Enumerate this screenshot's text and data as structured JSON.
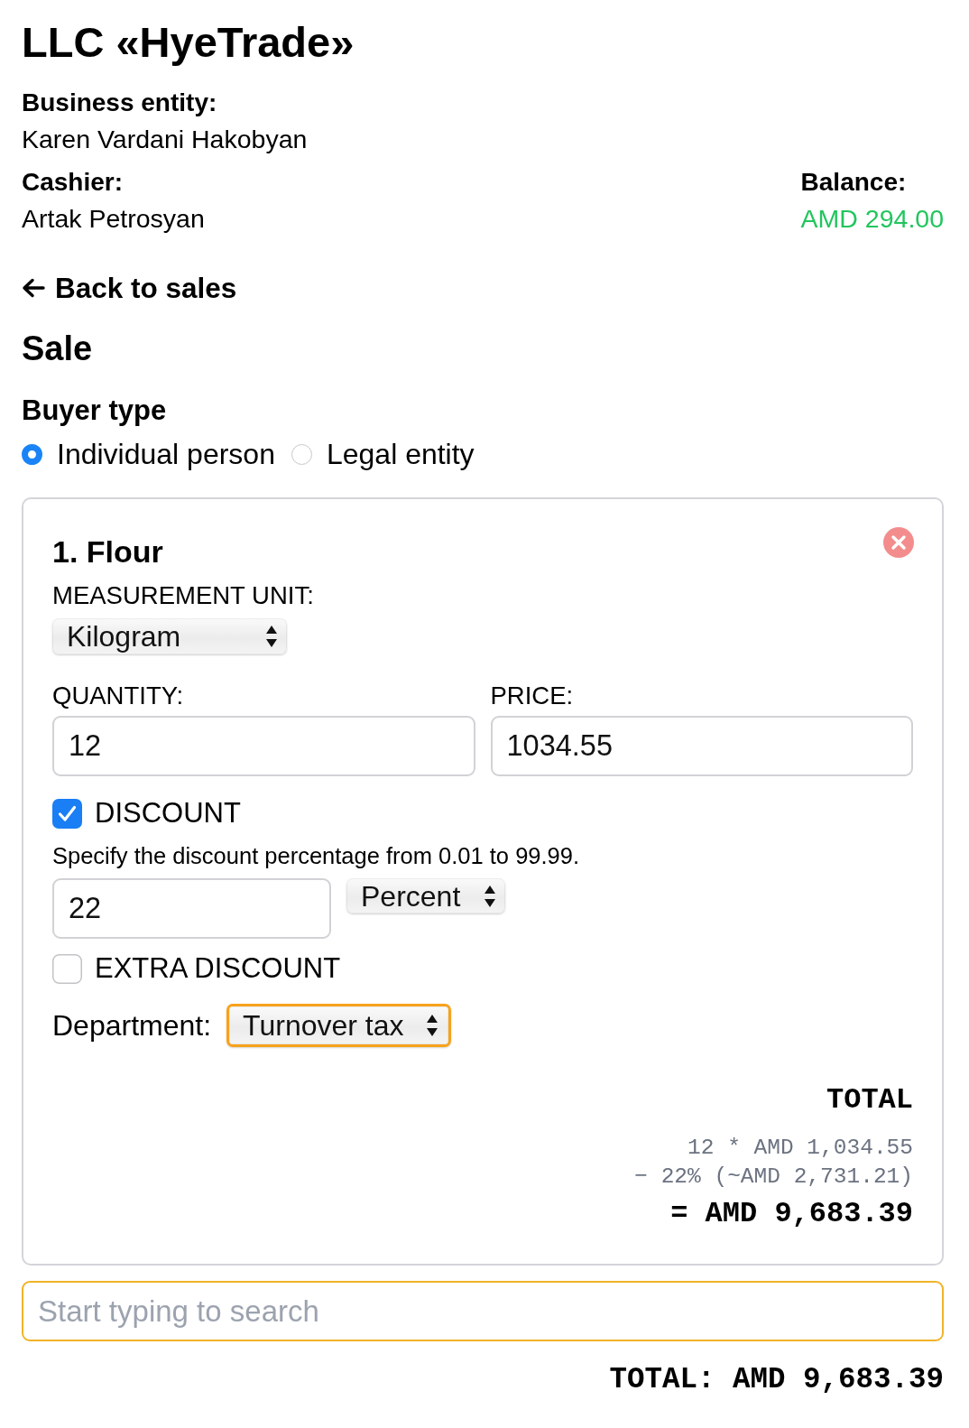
{
  "company": {
    "name": "LLC «HyeTrade»"
  },
  "info": {
    "business_entity": {
      "label": "Business entity:",
      "value": "Karen Vardani Hakobyan"
    },
    "cashier": {
      "label": "Cashier:",
      "value": "Artak Petrosyan"
    },
    "balance": {
      "label": "Balance:",
      "value": "AMD 294.00"
    }
  },
  "back_link": {
    "label": "Back to sales"
  },
  "page_title": "Sale",
  "buyer_type": {
    "label": "Buyer type",
    "options": [
      {
        "label": "Individual person",
        "selected": true
      },
      {
        "label": "Legal entity",
        "selected": false
      }
    ]
  },
  "items": [
    {
      "title": "1. Flour",
      "unit": {
        "label": "MEASUREMENT UNIT:",
        "value": "Kilogram"
      },
      "quantity": {
        "label": "QUANTITY:",
        "value": "12"
      },
      "price": {
        "label": "PRICE:",
        "value": "1034.55"
      },
      "discount": {
        "label": "DISCOUNT",
        "checked": true,
        "hint": "Specify the discount percentage from 0.01 to 99.99.",
        "value": "22",
        "type": "Percent"
      },
      "extra_discount": {
        "label": "EXTRA DISCOUNT",
        "checked": false
      },
      "department": {
        "label": "Department:",
        "value": "Turnover tax",
        "highlighted": true
      },
      "total": {
        "label": "TOTAL",
        "lines": [
          "12 * AMD 1,034.55",
          "− 22% (~AMD 2,731.21)"
        ],
        "result": "= AMD 9,683.39"
      }
    }
  ],
  "search": {
    "placeholder": "Start typing to search"
  },
  "grand_total": "TOTAL: AMD 9,683.39"
}
